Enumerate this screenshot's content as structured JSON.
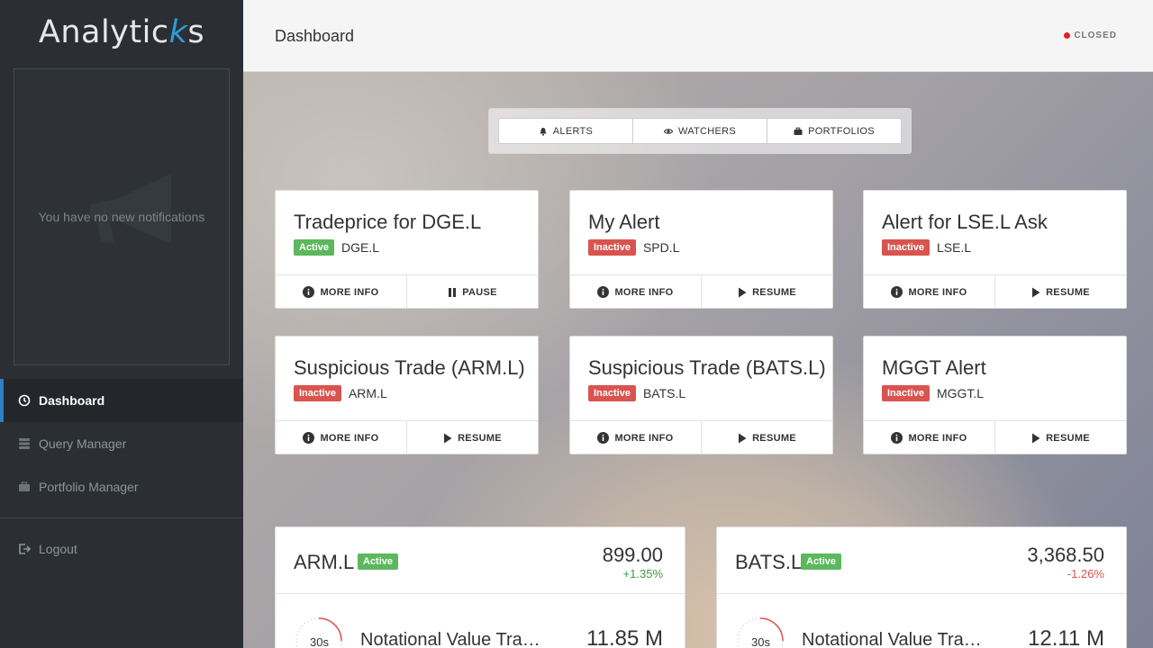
{
  "sidebar": {
    "logo_prefix": "Analytic",
    "logo_accent": "k",
    "logo_suffix": "s",
    "notifications_empty": "You have no new notifications",
    "nav": [
      {
        "label": "Dashboard",
        "icon": "dashboard-icon",
        "active": true
      },
      {
        "label": "Query Manager",
        "icon": "database-icon",
        "active": false
      },
      {
        "label": "Portfolio Manager",
        "icon": "briefcase-icon",
        "active": false
      }
    ],
    "logout": "Logout"
  },
  "header": {
    "title": "Dashboard",
    "status": "CLOSED",
    "status_color": "#e02020"
  },
  "tabs": [
    {
      "label": "ALERTS",
      "icon": "bell-icon"
    },
    {
      "label": "WATCHERS",
      "icon": "eye-icon"
    },
    {
      "label": "PORTFOLIOS",
      "icon": "briefcase-icon"
    }
  ],
  "alerts": [
    {
      "title": "Tradeprice for DGE.L",
      "status": "Active",
      "symbol": "DGE.L",
      "more": "MORE INFO",
      "action": "PAUSE"
    },
    {
      "title": "My Alert",
      "status": "Inactive",
      "symbol": "SPD.L",
      "more": "MORE INFO",
      "action": "RESUME"
    },
    {
      "title": "Alert for LSE.L Ask",
      "status": "Inactive",
      "symbol": "LSE.L",
      "more": "MORE INFO",
      "action": "RESUME"
    },
    {
      "title": "Suspicious Trade (ARM.L)",
      "status": "Inactive",
      "symbol": "ARM.L",
      "more": "MORE INFO",
      "action": "RESUME"
    },
    {
      "title": "Suspicious Trade (BATS.L)",
      "status": "Inactive",
      "symbol": "BATS.L",
      "more": "MORE INFO",
      "action": "RESUME"
    },
    {
      "title": "MGGT Alert",
      "status": "Inactive",
      "symbol": "MGGT.L",
      "more": "MORE INFO",
      "action": "RESUME"
    }
  ],
  "stocks": [
    {
      "symbol": "ARM.L",
      "status": "Active",
      "price": "899.00",
      "change": "+1.35%",
      "timer": "30s",
      "metric_label": "Notational Value Tra…",
      "metric_value": "11.85 M"
    },
    {
      "symbol": "BATS.L",
      "status": "Active",
      "price": "3,368.50",
      "change": "-1.26%",
      "timer": "30s",
      "metric_label": "Notational Value Tra…",
      "metric_value": "12.11 M"
    }
  ],
  "colors": {
    "active_badge": "#5cb85c",
    "inactive_badge": "#d9534f",
    "accent": "#2f7fc1"
  }
}
